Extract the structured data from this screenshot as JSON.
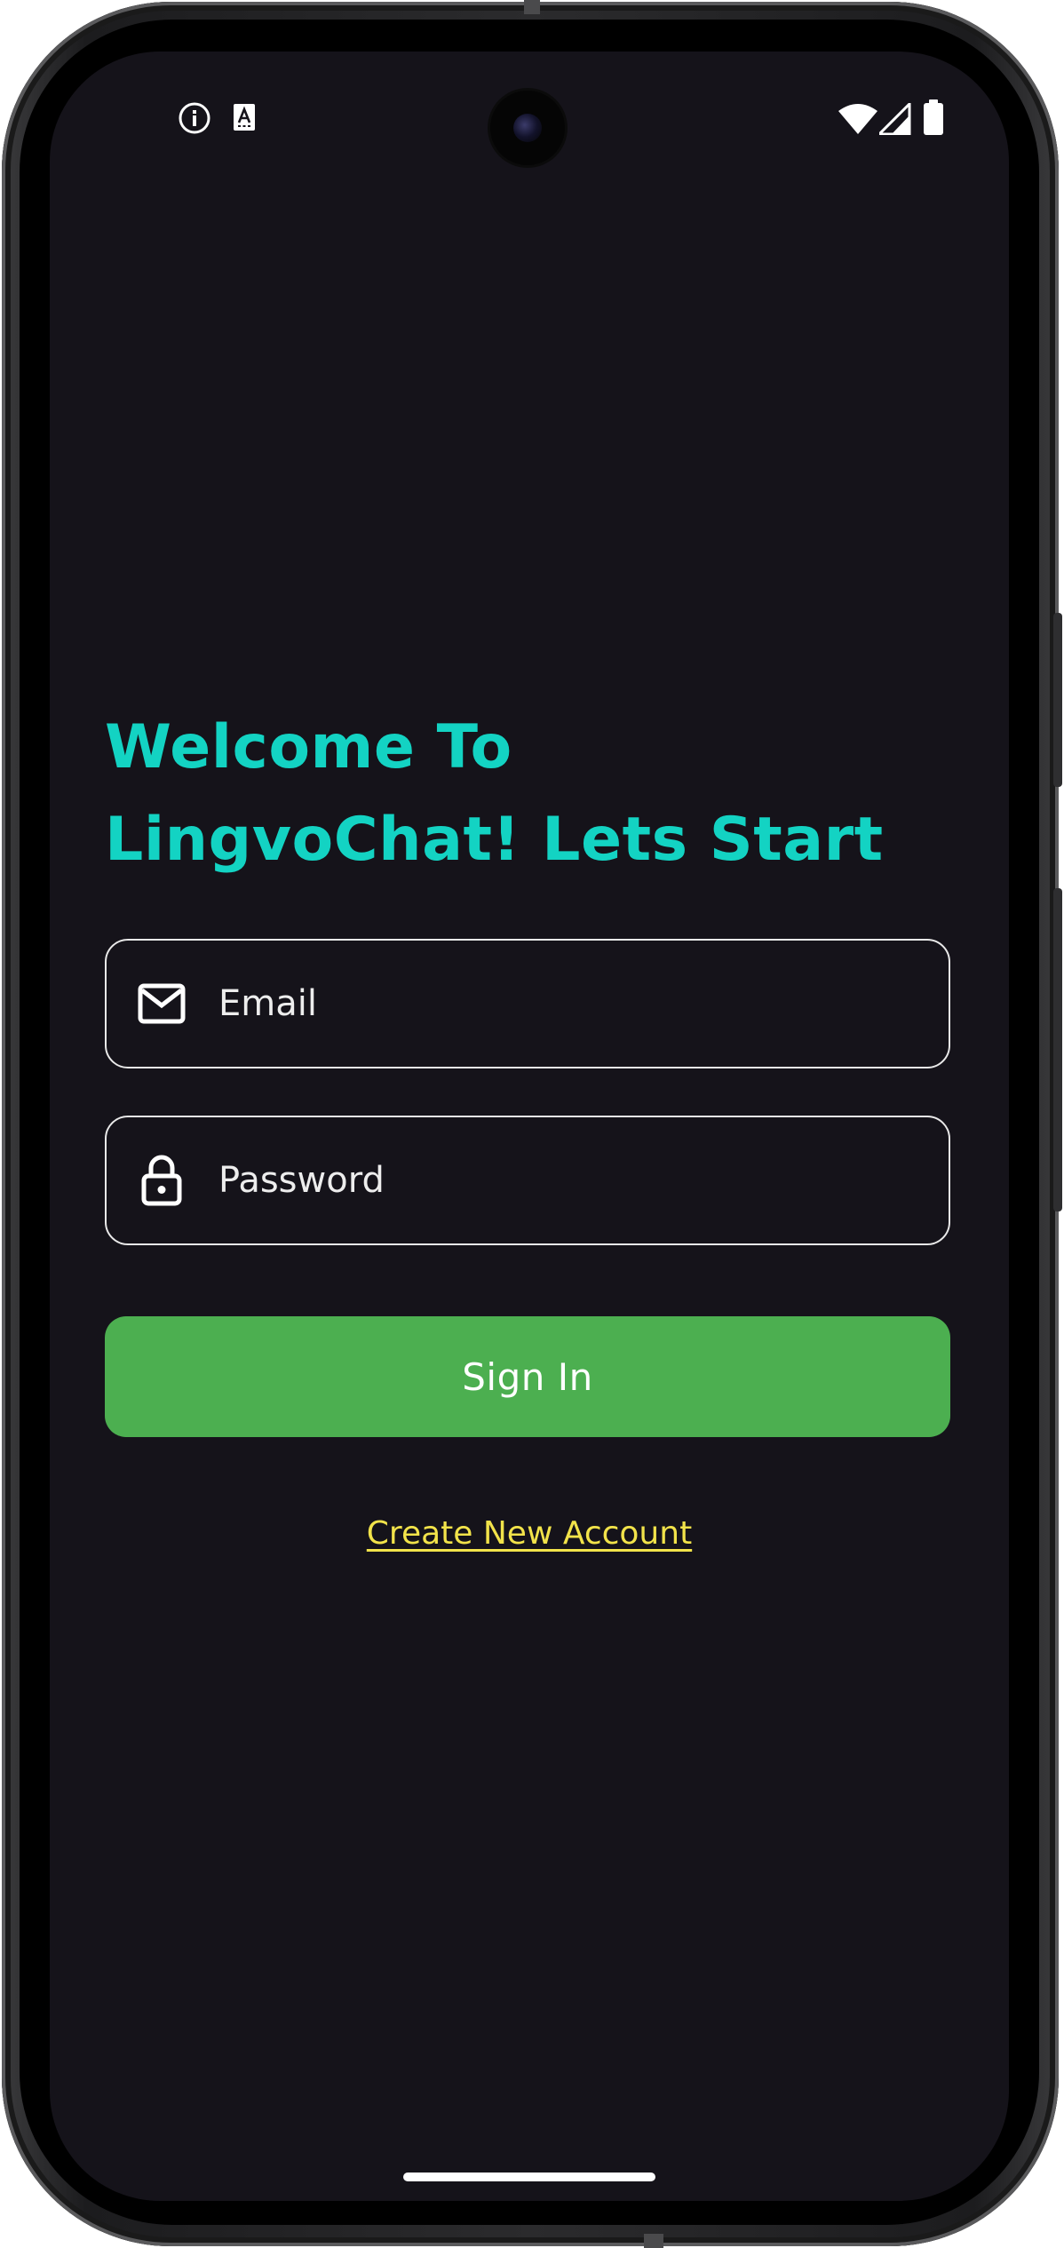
{
  "status_bar": {
    "left_icons": [
      "info-icon",
      "keyboard-a-icon"
    ],
    "right_icons": [
      "wifi-icon",
      "cell-signal-icon",
      "battery-icon"
    ]
  },
  "login": {
    "title_line1": "Welcome To",
    "title_line2": "LingvoChat! Lets Start",
    "email_placeholder": "Email",
    "password_placeholder": "Password",
    "sign_in_label": "Sign In",
    "create_account_label": "Create New Account"
  },
  "colors": {
    "background": "#15131a",
    "title": "#13d3c3",
    "button": "#4caf50",
    "link": "#f2e34a",
    "field_border": "#e9e9e9"
  }
}
